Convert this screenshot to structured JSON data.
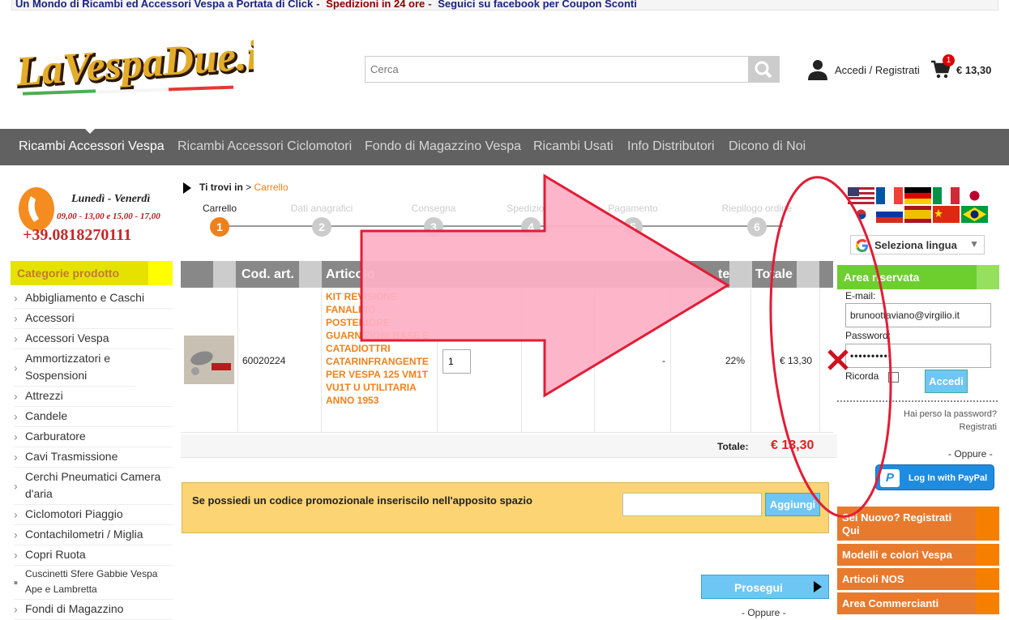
{
  "topbar": {
    "part1": "Un Mondo di Ricambi ed Accessori Vespa a Portata di Click",
    "sep1": "-",
    "part2": "Spedizioni in 24 ore",
    "sep2": "-",
    "part3": "Seguici su facebook per Coupon Sconti",
    "colors": {
      "part1": "#1a237e",
      "part2": "#8b0000",
      "part3": "#1a237e"
    }
  },
  "logo": {
    "text": "LaVespaDue.it"
  },
  "search": {
    "placeholder": "Cerca",
    "icon": "search-icon"
  },
  "account": {
    "label": "Accedi / Registrati",
    "icon": "user-icon"
  },
  "cart": {
    "count": "1",
    "amount": "€ 13,30",
    "icon": "cart-icon"
  },
  "nav": {
    "items": [
      "Ricambi Accessori Vespa",
      "Ricambi Accessori Ciclomotori",
      "Fondo di Magazzino Vespa",
      "Ricambi Usati",
      "Info Distributori",
      "Dicono di Noi"
    ],
    "active": 0
  },
  "phone": {
    "days": "Lunedì - Venerdì",
    "hours": "09,00 - 13,00 e 15,00 - 17,00",
    "number": "+39.0818270111"
  },
  "categories": {
    "title": "Categorie prodotto",
    "items": [
      "Abbigliamento e Caschi",
      "Accessori",
      "Accessori Vespa",
      "Ammortizzatori e Sospensioni",
      "Attrezzi",
      "Candele",
      "Carburatore",
      "Cavi Trasmissione",
      "Cerchi Pneumatici Camera d'aria",
      "Ciclomotori Piaggio",
      "Contachilometri / Miglia",
      "Copri Ruota",
      "Cuscinetti Sfere Gabbie Vespa Ape e Lambretta",
      "Fondi di Magazzino"
    ]
  },
  "breadcrumb": {
    "prefix": "Ti trovi in",
    "sep": ">",
    "current": "Carrello"
  },
  "steps": [
    {
      "label": "Carrello",
      "num": "1"
    },
    {
      "label": "Dati anagrafici",
      "num": "2"
    },
    {
      "label": "Consegna",
      "num": "3"
    },
    {
      "label": "Spedizione",
      "num": "4"
    },
    {
      "label": "Pagamento",
      "num": "5"
    },
    {
      "label": "Riepilogo ordine",
      "num": "6"
    }
  ],
  "table": {
    "headers": [
      "Cod. art.",
      "Articolo",
      "te",
      "Totale"
    ],
    "row": {
      "code": "60020224",
      "name": "KIT REVISIONE FANALINO POSTERIORE GUARNIZIONI BASE E CATADIOTTRI CATARINFRANGENTE PER VESPA 125 VM1T VU1T U UTILITARIA ANNO 1953",
      "qty": "1",
      "dash": "-",
      "vat": "22%",
      "total": "€ 13,30"
    },
    "total_label": "Totale:",
    "total_value": "€ 13,30"
  },
  "promo": {
    "text": "Se possiedi un codice promozionale inseriscilo nell'apposito spazio",
    "button": "Aggiungi"
  },
  "prosegui": {
    "label": "Prosegui",
    "oppure": "- Oppure -"
  },
  "language": {
    "label": "Seleziona lingua"
  },
  "login": {
    "title": "Area riservata",
    "email_label": "E-mail:",
    "email_value": "brunoottaviano@virgilio.it",
    "password_label": "Password:",
    "password_value": "••••••••••",
    "remember": "Ricorda",
    "button": "Accedi",
    "forgot": "Hai perso la password?",
    "register": "Registrati",
    "oppure": "- Oppure -",
    "paypal": "Log In with PayPal"
  },
  "side_boxes": [
    "Sei Nuovo? Registrati Qui",
    "Modelli e colori Vespa",
    "Articoli NOS",
    "Area Commercianti"
  ]
}
